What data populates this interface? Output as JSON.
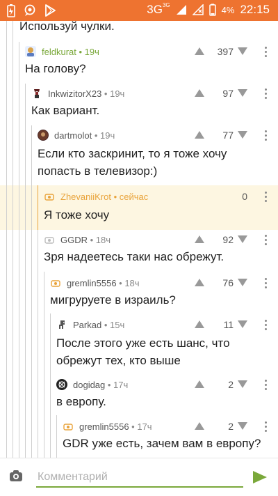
{
  "status_bar": {
    "network": "3G",
    "network_sup": "3G",
    "battery_pct": "4%",
    "time": "22:15",
    "icons": [
      "battery-charging-icon",
      "bubble-icon",
      "play-store-icon",
      "signal-icon",
      "no-sim-icon",
      "battery-low-icon"
    ]
  },
  "top_text": "Используй чулки.",
  "comments": [
    {
      "user": "feldkurat",
      "time": " • 19ч",
      "text": "На голову?",
      "score": "397",
      "name_color": "green",
      "avatar": "avatar-feldkurat"
    },
    {
      "user": "InkwizitorX23",
      "time": " • 19ч",
      "text": "Как вариант.",
      "score": "97",
      "name_color": "gray",
      "avatar": "avatar-inkwizitor"
    },
    {
      "user": "dartmolot",
      "time": " • 19ч",
      "text": "Если кто заскринит, то я тоже хочу попасть в телевизор:)",
      "score": "77",
      "name_color": "gray",
      "avatar": "avatar-dartmolot"
    },
    {
      "user": "ZhevaniiKrot",
      "time": " • сейчас",
      "text": "Я тоже хочу",
      "score": "0",
      "name_color": "orange",
      "avatar": "avatar-zhevaniikrot",
      "highlight": true
    },
    {
      "user": "GGDR",
      "time": " • 18ч",
      "text": "Зря надеетесь таки нас обрежут.",
      "score": "92",
      "name_color": "gray",
      "avatar": "avatar-ggdr"
    },
    {
      "user": "gremlin5556",
      "time": " • 18ч",
      "text": "мигруруете в израиль?",
      "score": "76",
      "name_color": "gray",
      "avatar": "avatar-gremlin"
    },
    {
      "user": "Parkad",
      "time": " • 15ч",
      "text": "После этого уже есть шанс, что обрежут тех, кто выше",
      "score": "11",
      "name_color": "gray",
      "avatar": "avatar-parkad"
    },
    {
      "user": "dogidag",
      "time": " • 17ч",
      "text": "в европу.",
      "score": "2",
      "name_color": "gray",
      "avatar": "avatar-dogidag"
    },
    {
      "user": "gremlin5556",
      "time": " • 17ч",
      "text": "GDR уже есть, зачем вам в европу?",
      "score": "2",
      "name_color": "gray",
      "avatar": "avatar-gremlin"
    }
  ],
  "input": {
    "placeholder": "Комментарий",
    "icons": [
      "camera-icon",
      "send-icon"
    ]
  },
  "colors": {
    "status_bar": "#ee7330",
    "accent_green": "#7aa83a",
    "accent_orange": "#e9a33a",
    "highlight_bg": "#fdf6e1"
  }
}
